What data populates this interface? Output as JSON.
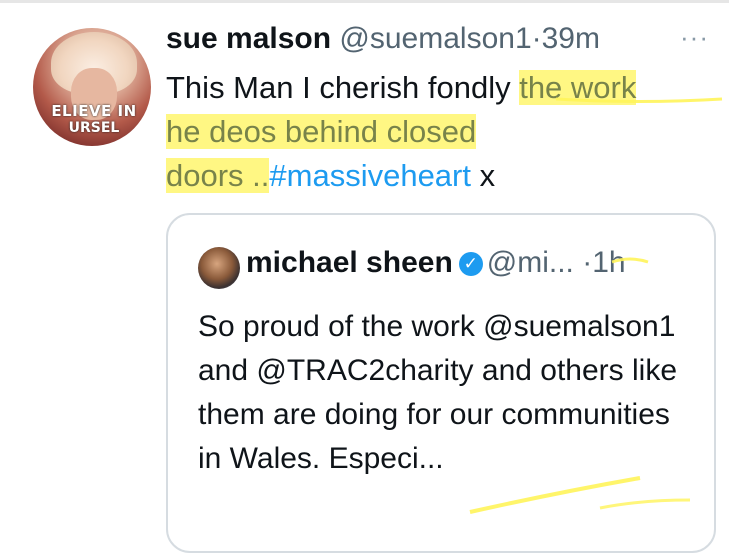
{
  "tweet": {
    "author_name": "sue malson",
    "author_handle": "@suemalson1",
    "separator": "·",
    "time": "39m",
    "more_label": "···",
    "avatar_banner_line1": "ELIEVE IN",
    "avatar_banner_line2": "URSEL",
    "text_plain": "This Man I cherish fondly ",
    "text_highlight_1": "the work",
    "text_highlight_2": "he deos behind closed",
    "text_highlight_3": "doors ..",
    "hashtag": "#massiveheart",
    "text_tail": " x"
  },
  "quoted_tweet": {
    "author_name": "michael sheen",
    "verified_mark": "✓",
    "author_handle": "@mi...",
    "separator": "·",
    "time": "1h",
    "text": "So proud of the work @suemalson1 and @TRAC2charity and others like them are doing for our communities in Wales. Especi..."
  },
  "colors": {
    "highlight": "#fff45a",
    "link": "#1d9bf0",
    "muted": "#536471",
    "border": "#d6dce1"
  }
}
